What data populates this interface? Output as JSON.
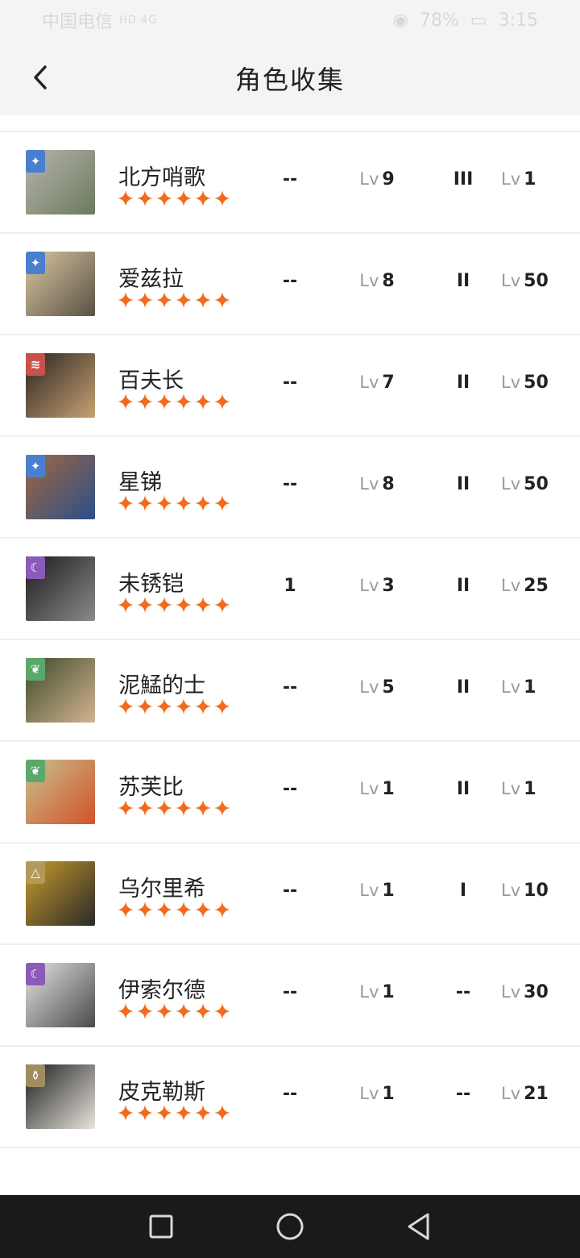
{
  "status_bar": {
    "carrier": "中国电信",
    "signal_text": "HD 4G",
    "battery": "78%",
    "time": "3:15"
  },
  "header": {
    "title": "角色收集"
  },
  "characters": [
    {
      "name": "北方哨歌",
      "element": "blue",
      "element_glyph": "✦",
      "col1": "--",
      "lv1_label": "Lv",
      "lv1": "9",
      "rank": "III",
      "lv2_label": "Lv",
      "lv2": "1",
      "stars": 6,
      "avatar_colors": [
        "#b8b4ad",
        "#6b7a5e"
      ]
    },
    {
      "name": "爱兹拉",
      "element": "blue",
      "element_glyph": "✦",
      "col1": "--",
      "lv1_label": "Lv",
      "lv1": "8",
      "rank": "II",
      "lv2_label": "Lv",
      "lv2": "50",
      "stars": 6,
      "avatar_colors": [
        "#d9c79e",
        "#5a5146"
      ]
    },
    {
      "name": "百夫长",
      "element": "red",
      "element_glyph": "≋",
      "col1": "--",
      "lv1_label": "Lv",
      "lv1": "7",
      "rank": "II",
      "lv2_label": "Lv",
      "lv2": "50",
      "stars": 6,
      "avatar_colors": [
        "#2a2422",
        "#c9a172"
      ]
    },
    {
      "name": "星锑",
      "element": "blue",
      "element_glyph": "✦",
      "col1": "--",
      "lv1_label": "Lv",
      "lv1": "8",
      "rank": "II",
      "lv2_label": "Lv",
      "lv2": "50",
      "stars": 6,
      "avatar_colors": [
        "#a0673f",
        "#2c4f8a"
      ]
    },
    {
      "name": "未锈铠",
      "element": "purple",
      "element_glyph": "☾",
      "col1": "1",
      "lv1_label": "Lv",
      "lv1": "3",
      "rank": "II",
      "lv2_label": "Lv",
      "lv2": "25",
      "stars": 6,
      "avatar_colors": [
        "#1c1c1c",
        "#8a8a8a"
      ]
    },
    {
      "name": "泥鯭的士",
      "element": "green",
      "element_glyph": "❦",
      "col1": "--",
      "lv1_label": "Lv",
      "lv1": "5",
      "rank": "II",
      "lv2_label": "Lv",
      "lv2": "1",
      "stars": 6,
      "avatar_colors": [
        "#3d4a2c",
        "#d3b48f"
      ]
    },
    {
      "name": "苏芙比",
      "element": "green",
      "element_glyph": "❦",
      "col1": "--",
      "lv1_label": "Lv",
      "lv1": "1",
      "rank": "II",
      "lv2_label": "Lv",
      "lv2": "1",
      "stars": 6,
      "avatar_colors": [
        "#c9c08d",
        "#d0532a"
      ]
    },
    {
      "name": "乌尔里希",
      "element": "gold",
      "element_glyph": "△",
      "col1": "--",
      "lv1_label": "Lv",
      "lv1": "1",
      "rank": "I",
      "lv2_label": "Lv",
      "lv2": "10",
      "stars": 6,
      "avatar_colors": [
        "#c89a2a",
        "#2a2a2a"
      ]
    },
    {
      "name": "伊索尔德",
      "element": "purple",
      "element_glyph": "☾",
      "col1": "--",
      "lv1_label": "Lv",
      "lv1": "1",
      "rank": "--",
      "lv2_label": "Lv",
      "lv2": "30",
      "stars": 6,
      "avatar_colors": [
        "#e4e4e4",
        "#4a4a4a"
      ]
    },
    {
      "name": "皮克勒斯",
      "element": "olive",
      "element_glyph": "⚱",
      "col1": "--",
      "lv1_label": "Lv",
      "lv1": "1",
      "rank": "--",
      "lv2_label": "Lv",
      "lv2": "21",
      "stars": 6,
      "avatar_colors": [
        "#1e1e1e",
        "#e8e4dd"
      ]
    }
  ],
  "element_colors": {
    "blue": "#4a7fd0",
    "red": "#c8514a",
    "purple": "#8a5bb8",
    "green": "#5aa86a",
    "gold": "#b39a5a",
    "olive": "#a08c5e"
  },
  "star_color": "#f26a1b",
  "nav": {
    "square": "square-icon",
    "circle": "circle-icon",
    "back": "triangle-back-icon"
  }
}
